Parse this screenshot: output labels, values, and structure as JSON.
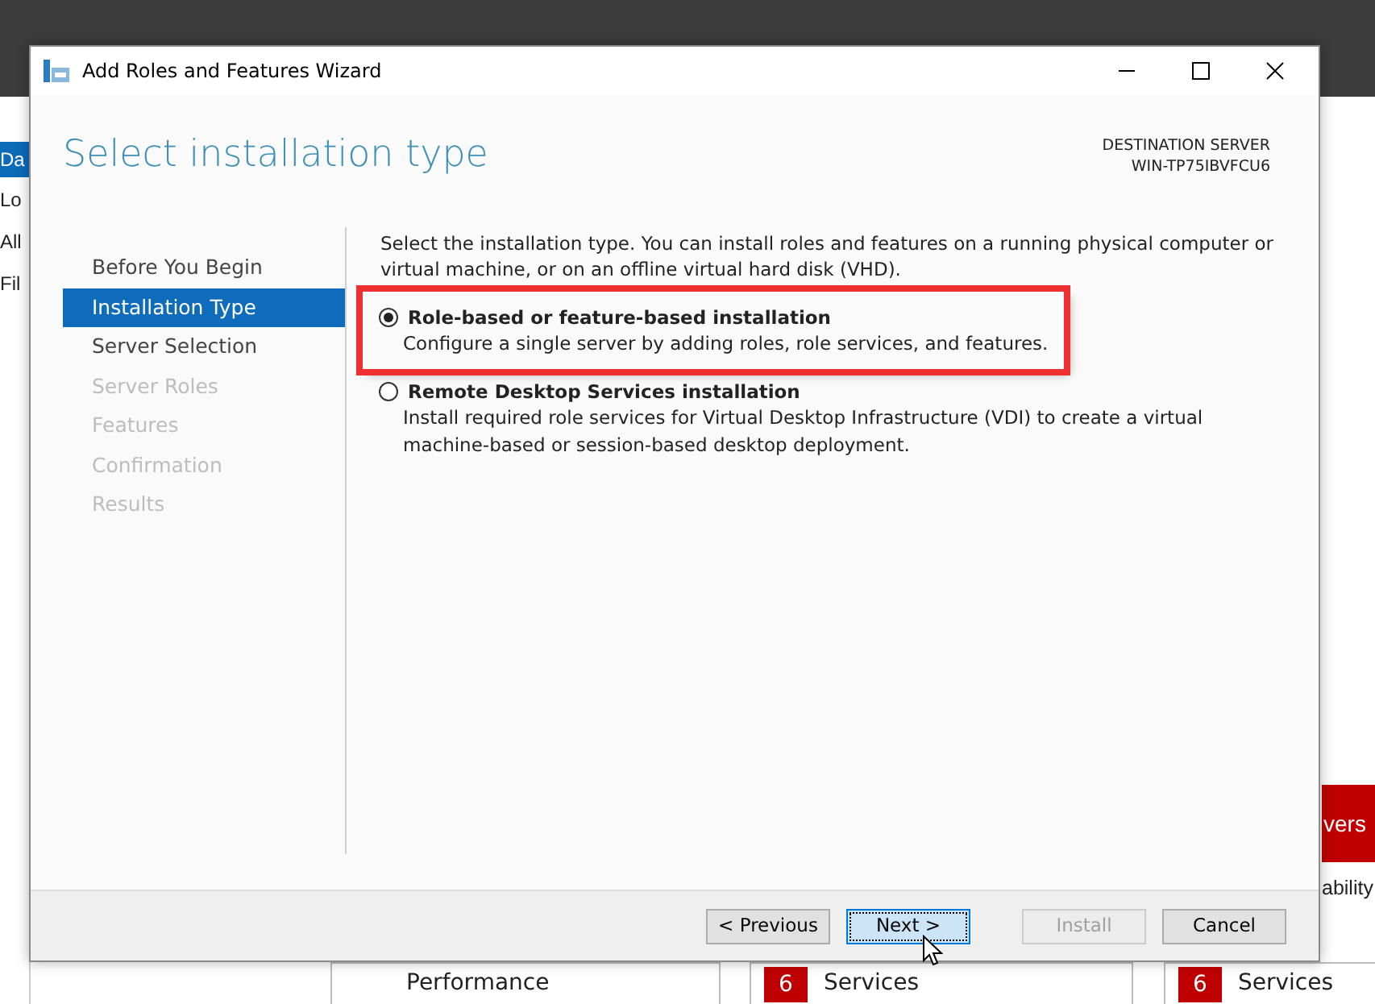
{
  "background": {
    "sidebar": [
      {
        "label": "Da",
        "selected": true
      },
      {
        "label": "Lo",
        "selected": false
      },
      {
        "label": "All",
        "selected": false
      },
      {
        "label": "Fil",
        "selected": false
      }
    ],
    "tile": {
      "label": "vers"
    },
    "side_text": "ability",
    "tiles": [
      {
        "label": "Performance"
      },
      {
        "count": "6",
        "label": "Services"
      },
      {
        "count": "6",
        "label": "Services"
      }
    ]
  },
  "window": {
    "title": "Add Roles and Features Wizard"
  },
  "header": {
    "title": "Select installation type",
    "destination_label": "DESTINATION SERVER",
    "destination_server": "WIN-TP75IBVFCU6"
  },
  "steps": [
    {
      "label": "Before You Begin",
      "selected": false,
      "disabled": false
    },
    {
      "label": "Installation Type",
      "selected": true,
      "disabled": false
    },
    {
      "label": "Server Selection",
      "selected": false,
      "disabled": false
    },
    {
      "label": "Server Roles",
      "selected": false,
      "disabled": true
    },
    {
      "label": "Features",
      "selected": false,
      "disabled": true
    },
    {
      "label": "Confirmation",
      "selected": false,
      "disabled": true
    },
    {
      "label": "Results",
      "selected": false,
      "disabled": true
    }
  ],
  "content": {
    "intro": "Select the installation type. You can install roles and features on a running physical computer or virtual machine, or on an offline virtual hard disk (VHD).",
    "options": [
      {
        "label": "Role-based or feature-based installation",
        "description": "Configure a single server by adding roles, role services, and features.",
        "selected": true,
        "highlighted": true
      },
      {
        "label": "Remote Desktop Services installation",
        "description": "Install required role services for Virtual Desktop Infrastructure (VDI) to create a virtual machine-based or session-based desktop deployment.",
        "selected": false,
        "highlighted": false
      }
    ]
  },
  "buttons": [
    {
      "label": "< Previous",
      "focused": false,
      "disabled": false
    },
    {
      "label": "Next >",
      "focused": true,
      "disabled": false
    },
    {
      "label": "Install",
      "focused": false,
      "disabled": true
    },
    {
      "label": "Cancel",
      "focused": false,
      "disabled": false
    }
  ]
}
